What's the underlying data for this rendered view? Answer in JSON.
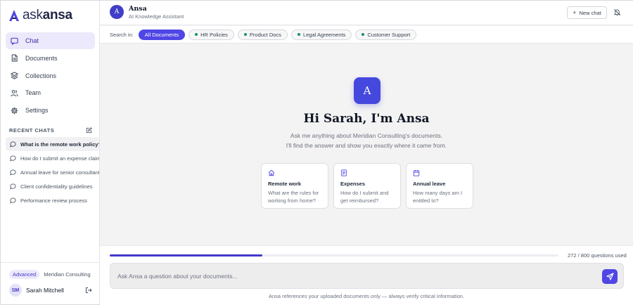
{
  "brand": {
    "light": "ask",
    "bold": "ansa",
    "accent": "#4f46e5"
  },
  "sidebar": {
    "nav": [
      {
        "label": "Chat",
        "icon": "chat-icon",
        "active": true
      },
      {
        "label": "Documents",
        "icon": "document-icon",
        "active": false
      },
      {
        "label": "Collections",
        "icon": "layers-icon",
        "active": false
      },
      {
        "label": "Team",
        "icon": "users-icon",
        "active": false
      },
      {
        "label": "Settings",
        "icon": "gear-icon",
        "active": false
      }
    ],
    "recent_title": "RECENT CHATS",
    "recent": [
      "What is the remote work policy?",
      "How do I submit an expense claim?",
      "Annual leave for senior consultants",
      "Client confidentiality guidelines",
      "Performance review process"
    ],
    "plan": "Advanced",
    "org": "Meridian Consulting",
    "user": {
      "initials": "SM",
      "name": "Sarah Mitchell"
    }
  },
  "header": {
    "avatar_letter": "A",
    "name": "Ansa",
    "subtitle": "AI Knowledge Assistant",
    "new_chat": "New chat"
  },
  "filters": {
    "label": "Search in:",
    "chips": [
      "All Documents",
      "HR Policies",
      "Product Docs",
      "Legal Agreements",
      "Customer Support"
    ],
    "dot_color": "#14936e"
  },
  "hero": {
    "logo_letter": "A",
    "title": "Hi Sarah, I'm Ansa",
    "line1": "Ask me anything about Meridian Consulting's documents.",
    "line2": "I'll find the answer and show you exactly where it came from."
  },
  "cards": [
    {
      "icon": "home-icon",
      "title": "Remote work",
      "body": "What are the rules for working from home?"
    },
    {
      "icon": "receipt-icon",
      "title": "Expenses",
      "body": "How do I submit and get reimbursed?"
    },
    {
      "icon": "calendar-icon",
      "title": "Annual leave",
      "body": "How many days am I entitled to?"
    }
  ],
  "usage": {
    "used": 272,
    "total": 800,
    "text": "272 / 800 questions used"
  },
  "composer": {
    "placeholder": "Ask Ansa a question about your documents...",
    "disclaimer": "Ansa references your uploaded documents only — always verify critical information."
  }
}
